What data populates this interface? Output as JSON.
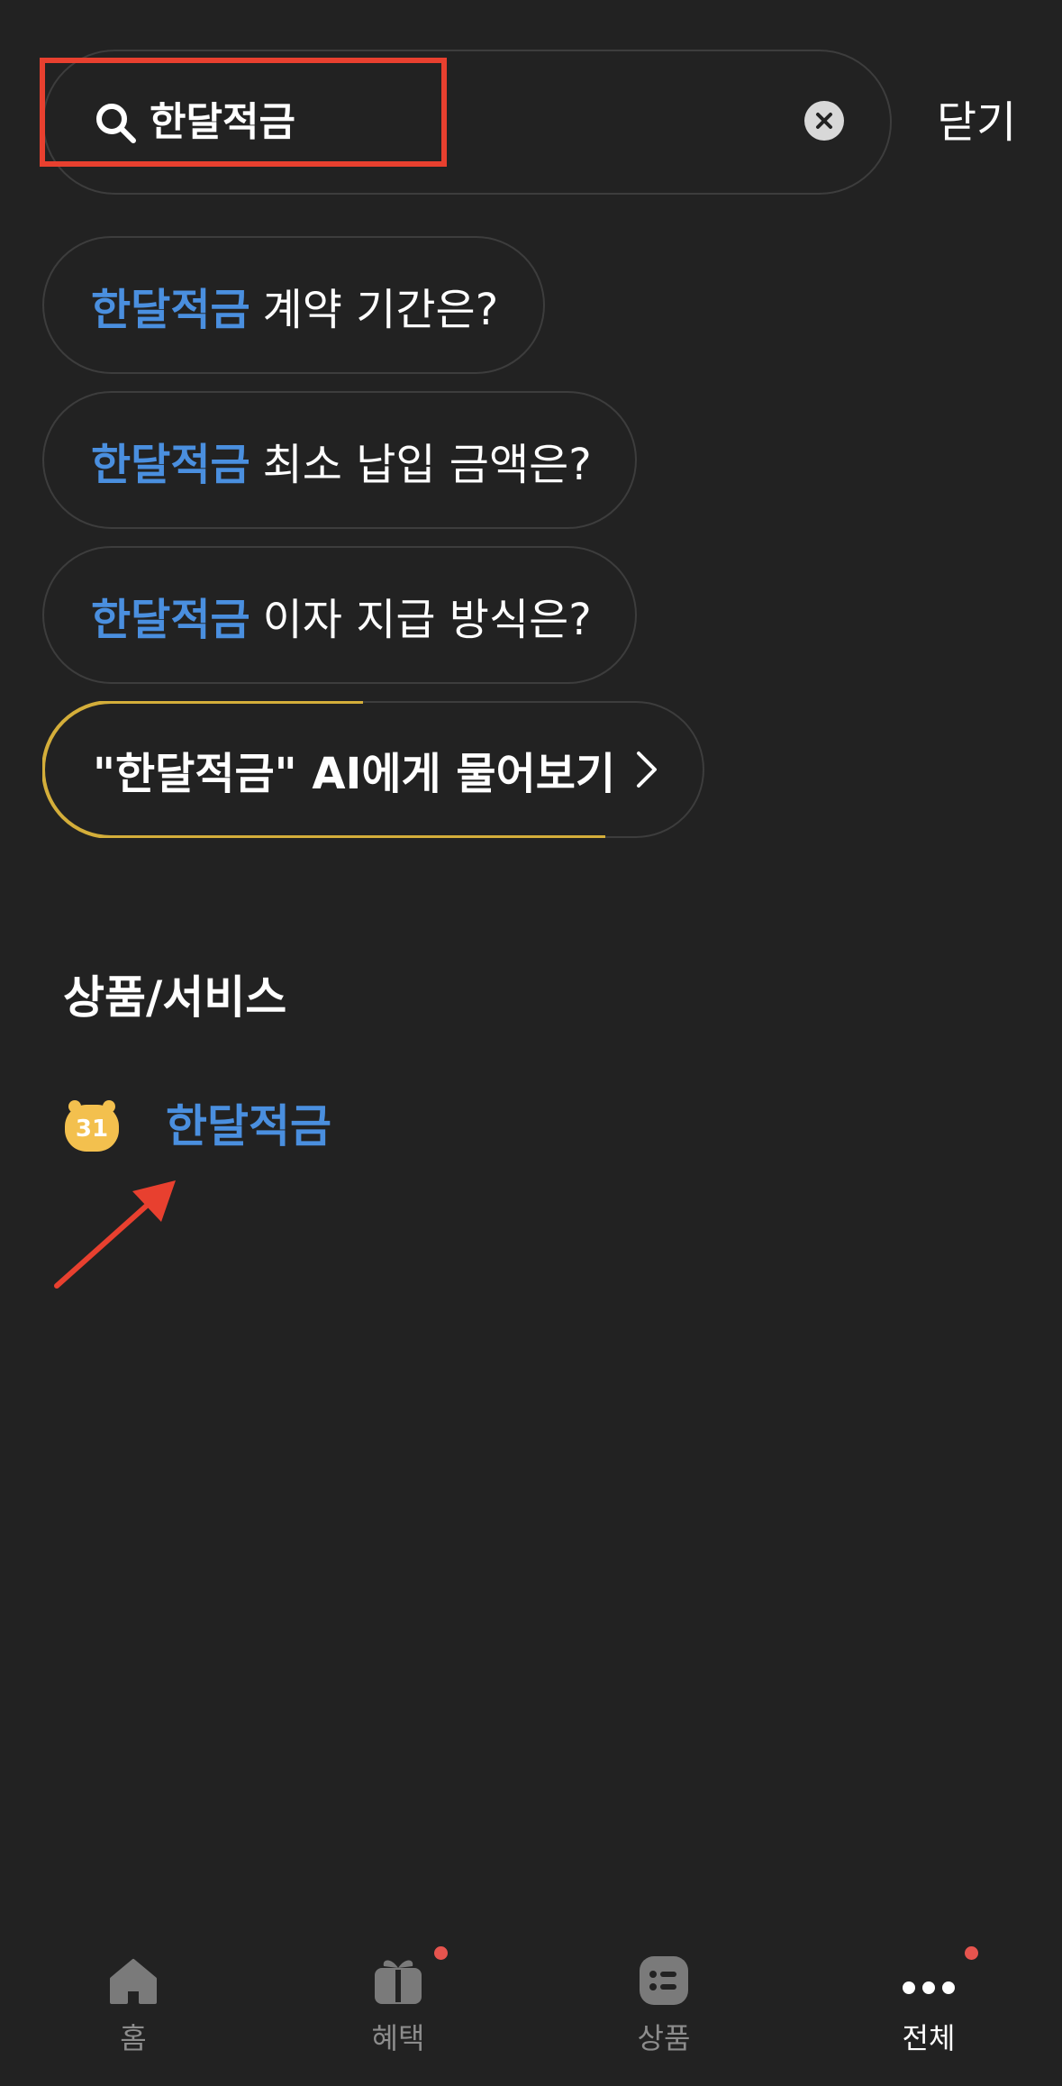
{
  "search": {
    "query": "한달적금",
    "clear_icon": "clear-circle-icon",
    "close_label": "닫기"
  },
  "suggestions": [
    {
      "keyword": "한달적금",
      "rest": "계약 기간은?"
    },
    {
      "keyword": "한달적금",
      "rest": "최소 납입 금액은?"
    },
    {
      "keyword": "한달적금",
      "rest": "이자 지급 방식은?"
    }
  ],
  "ai_prompt": {
    "label": "\"한달적금\" AI에게 물어보기"
  },
  "section": {
    "title": "상품/서비스",
    "items": [
      {
        "icon_text": "31",
        "name": "한달적금"
      }
    ]
  },
  "bottom_nav": [
    {
      "label": "홈",
      "icon": "home-icon",
      "badge": false,
      "active": false
    },
    {
      "label": "혜택",
      "icon": "gift-icon",
      "badge": true,
      "active": false
    },
    {
      "label": "상품",
      "icon": "list-icon",
      "badge": false,
      "active": false
    },
    {
      "label": "전체",
      "icon": "more-icon",
      "badge": true,
      "active": true
    }
  ],
  "colors": {
    "background": "#222222",
    "keyword_blue": "#4a8fdf",
    "highlight_red": "#e8402f",
    "ai_gold": "#d4ae3a",
    "badge_red": "#e6544e"
  }
}
